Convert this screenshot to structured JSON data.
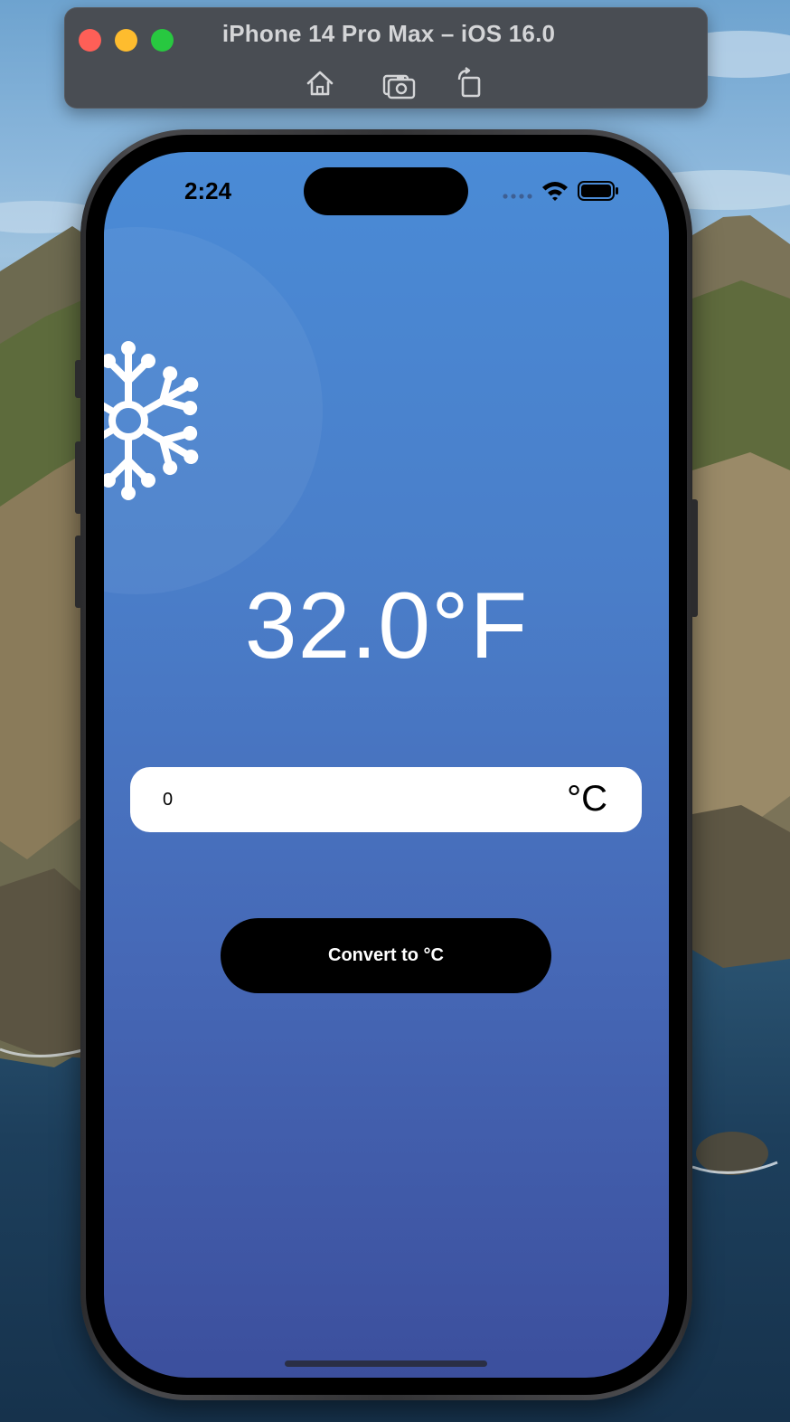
{
  "simulator": {
    "title": "iPhone 14 Pro Max – iOS 16.0",
    "tools": [
      {
        "icon": "home-icon"
      },
      {
        "icon": "screenshot-icon"
      },
      {
        "icon": "rotate-icon"
      }
    ]
  },
  "status_bar": {
    "time": "2:24",
    "icons": [
      "cellular-dots-icon",
      "wifi-icon",
      "battery-icon"
    ]
  },
  "app": {
    "weather_icon": "snowflake-icon",
    "temperature_display": "32.0°F",
    "input": {
      "value": "0",
      "placeholder": ""
    },
    "unit_label": "°C",
    "convert_button_label": "Convert to °C"
  },
  "colors": {
    "gradient_top": "#4a8bd6",
    "gradient_bottom": "#3c4f9d",
    "button_bg": "#000000",
    "button_text": "#ffffff",
    "field_bg": "#ffffff",
    "sim_bar_bg": "#494d53"
  }
}
